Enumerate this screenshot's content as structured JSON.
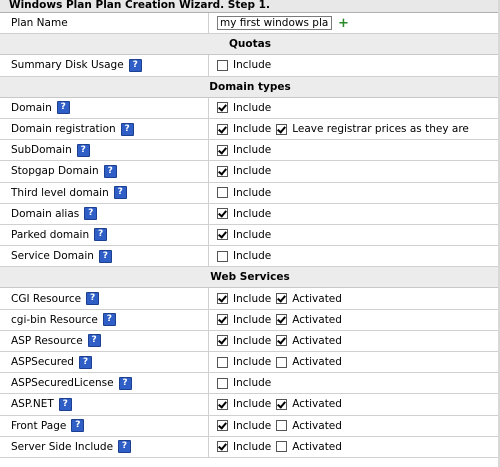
{
  "title": "Windows Plan Plan Creation Wizard. Step 1.",
  "plan_name": {
    "label": "Plan Name",
    "value": "my first windows plan"
  },
  "include_text": "Include",
  "activated_text": "Activated",
  "sections": {
    "quotas": "Quotas",
    "domain_types": "Domain types",
    "web_services": "Web Services"
  },
  "quota_rows": [
    {
      "label": "Summary Disk Usage",
      "include": false
    }
  ],
  "domain_rows": [
    {
      "label": "Domain",
      "include": true
    },
    {
      "label": "Domain registration",
      "include": true,
      "extra_label": "Leave registrar prices as they are",
      "extra_checked": true
    },
    {
      "label": "SubDomain",
      "include": true
    },
    {
      "label": "Stopgap Domain",
      "include": true
    },
    {
      "label": "Third level domain",
      "include": false
    },
    {
      "label": "Domain alias",
      "include": true
    },
    {
      "label": "Parked domain",
      "include": true
    },
    {
      "label": "Service Domain",
      "include": false
    }
  ],
  "web_rows": [
    {
      "label": "CGI Resource",
      "include": true,
      "activated": true
    },
    {
      "label": "cgi-bin Resource",
      "include": true,
      "activated": true
    },
    {
      "label": "ASP Resource",
      "include": true,
      "activated": true
    },
    {
      "label": "ASPSecured",
      "include": false,
      "activated": false
    },
    {
      "label": "ASPSecuredLicense",
      "include": false
    },
    {
      "label": "ASP.NET",
      "include": true,
      "activated": true
    },
    {
      "label": "Front Page",
      "include": true,
      "activated": false
    },
    {
      "label": "Server Side Include",
      "include": true,
      "activated": false
    }
  ],
  "colors": {
    "help_icon": "#2f5fc6",
    "add_icon": "#2a8a2a",
    "section_bg": "#ececec"
  },
  "icons": {
    "help": "help-icon",
    "add": "plus-icon"
  }
}
